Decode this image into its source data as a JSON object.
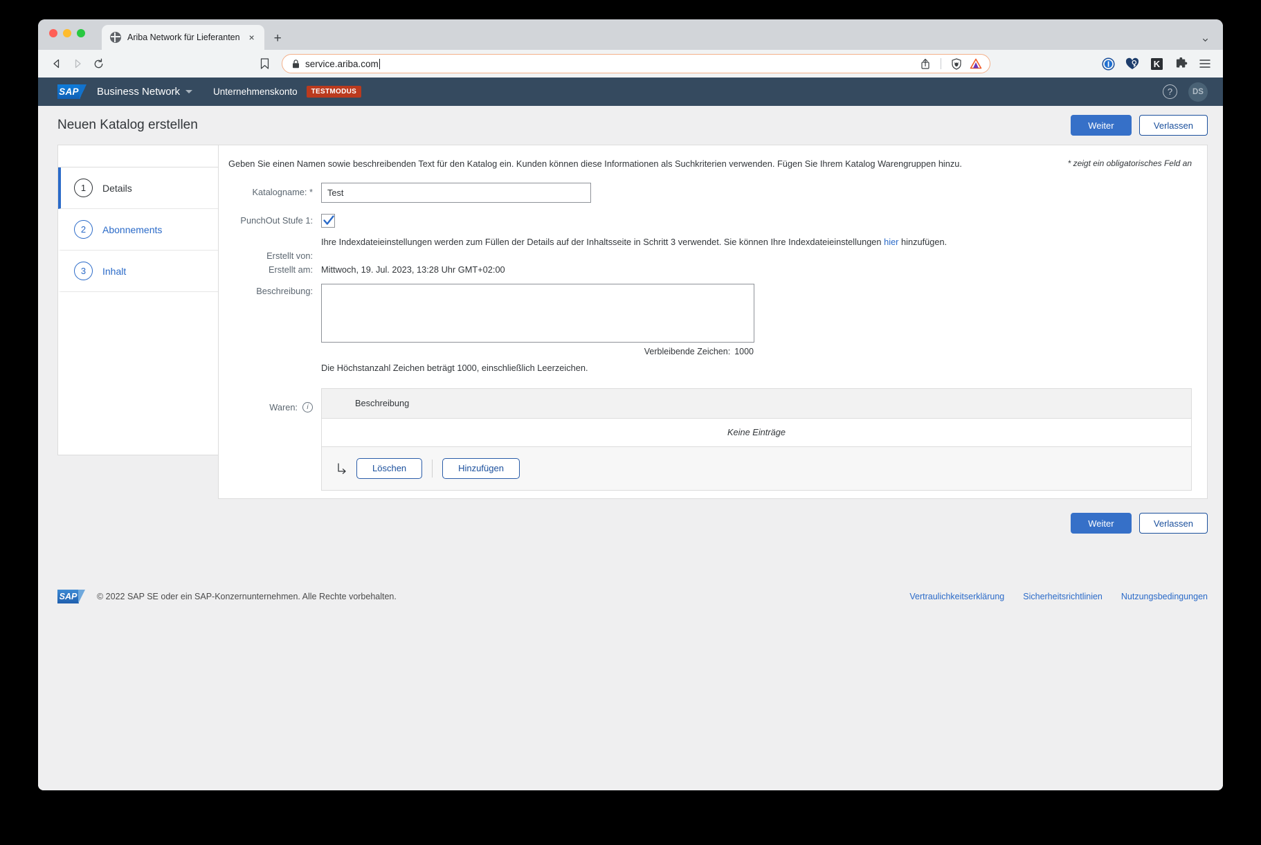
{
  "browser": {
    "tab": {
      "title": "Ariba Network für Lieferanten",
      "favicon": "globe-icon",
      "close": "×"
    },
    "new_tab": "+",
    "url": "service.ariba.com",
    "nav": {
      "back": "back-icon",
      "forward": "forward-icon",
      "reload": "reload-icon",
      "bookmark": "bookmark-icon",
      "share": "share-icon",
      "brave_shields": "brave-shields-icon",
      "brave_rewards": "brave-rewards-triangle-icon"
    },
    "extensions": [
      {
        "name": "1password-icon",
        "label": "1"
      },
      {
        "name": "heart-key-icon",
        "label": ""
      },
      {
        "name": "keepass-icon",
        "label": "K"
      },
      {
        "name": "extensions-puzzle-icon",
        "label": ""
      },
      {
        "name": "browser-menu-icon",
        "label": "≡"
      }
    ]
  },
  "sap_header": {
    "logo": "sap-logo",
    "logo_text": "SAP",
    "app_name": "Business Network",
    "account": "Unternehmenskonto",
    "badge": "TESTMODUS",
    "help": "?",
    "avatar_initials": "DS"
  },
  "page": {
    "title": "Neuen Katalog erstellen",
    "primary_action": "Weiter",
    "secondary_action": "Verlassen"
  },
  "wizard": {
    "steps": [
      {
        "num": "1",
        "label": "Details",
        "active": true
      },
      {
        "num": "2",
        "label": "Abonnements",
        "active": false
      },
      {
        "num": "3",
        "label": "Inhalt",
        "active": false
      }
    ]
  },
  "form": {
    "intro": "Geben Sie einen Namen sowie beschreibenden Text für den Katalog ein. Kunden können diese Informationen als Suchkriterien verwenden. Fügen Sie Ihrem Katalog Warengruppen hinzu.",
    "required_note": "* zeigt ein obligatorisches Feld an",
    "catalog_name": {
      "label": "Katalogname:",
      "required_marker": "*",
      "value": "Test"
    },
    "punchout": {
      "label": "PunchOut Stufe 1:",
      "checked": true
    },
    "index_note_before": "Ihre Indexdateieinstellungen werden zum Füllen der Details auf der Inhaltsseite in Schritt 3 verwendet. Sie können Ihre Indexdateieinstellungen ",
    "index_note_link": "hier",
    "index_note_after": " hinzufügen.",
    "created_by": {
      "label": "Erstellt von:",
      "value": ""
    },
    "created_at": {
      "label": "Erstellt am:",
      "value": "Mittwoch, 19. Jul. 2023, 13:28 Uhr GMT+02:00"
    },
    "description": {
      "label": "Beschreibung:",
      "value": "",
      "chars_remaining_label": "Verbleibende Zeichen:",
      "chars_remaining_value": "1000",
      "max_chars_note": "Die Höchstanzahl Zeichen beträgt 1000, einschließlich Leerzeichen."
    },
    "waren": {
      "label": "Waren:",
      "info_icon": "i",
      "column_header": "Beschreibung",
      "empty_text": "Keine Einträge",
      "delete_button": "Löschen",
      "add_button": "Hinzufügen"
    }
  },
  "footer": {
    "logo_text": "SAP",
    "copyright": "© 2022 SAP SE oder ein SAP-Konzernunternehmen. Alle Rechte vorbehalten.",
    "links": [
      "Vertraulichkeitserklärung",
      "Sicherheitsrichtlinien",
      "Nutzungsbedingungen"
    ]
  }
}
